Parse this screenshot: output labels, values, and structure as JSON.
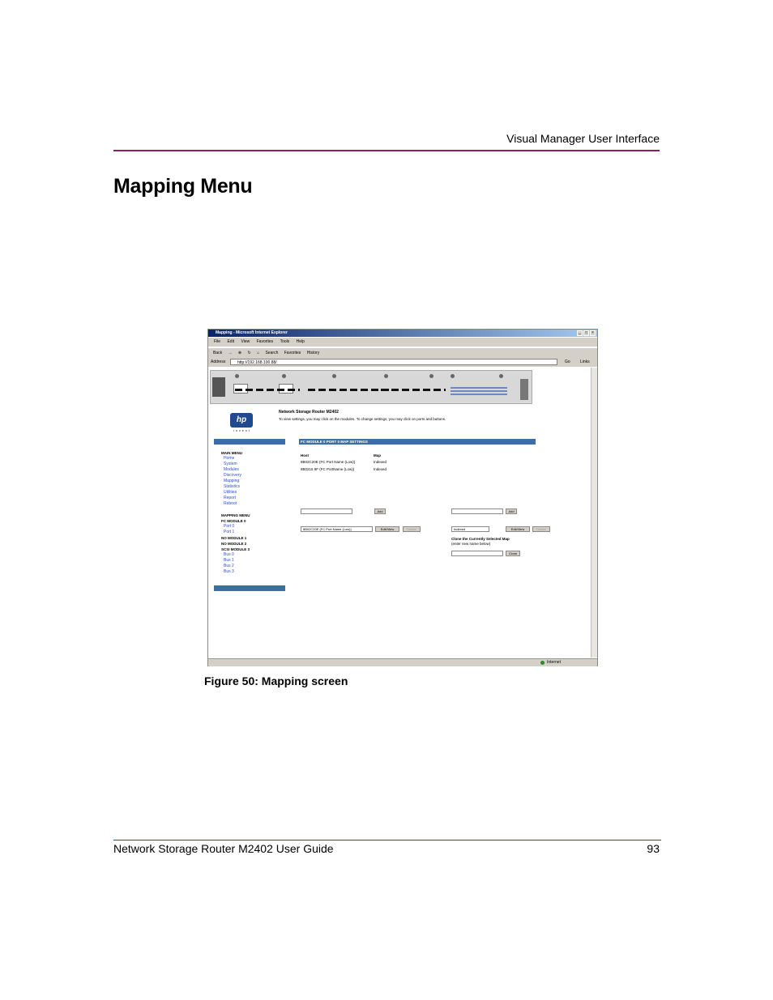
{
  "page": {
    "running_header": "Visual Manager User Interface",
    "section_title": "Mapping Menu",
    "caption": "Figure 50:  Mapping screen",
    "footer_left": "Network Storage Router M2402 User Guide",
    "footer_right": "93",
    "rule_color": "#8a1e6c"
  },
  "screenshot": {
    "window_title": "Mapping - Microsoft Internet Explorer",
    "menu": [
      "File",
      "Edit",
      "View",
      "Favorites",
      "Tools",
      "Help"
    ],
    "toolbar": [
      "Back",
      "Search",
      "Favorites",
      "History"
    ],
    "address_label": "Address",
    "address_value": "http://192.168.100.88/",
    "go_label": "Go",
    "links_label": "Links",
    "status_zone": "Internet",
    "logo_text": "hp",
    "logo_tagline": "invent",
    "router_title": "Network Storage Router M2402",
    "router_instructions": "To view settings, you may click on the modules. To change settings, you may click on ports and buttons.",
    "settings_header": "FC MODULE 0 PORT 0 MAP SETTINGS",
    "host_header": "Host",
    "map_header": "Map",
    "hosts": [
      {
        "host": "8B02C20E (FC Port Name (Low))",
        "map": "Indexed"
      },
      {
        "host": "8B0215 9F (FC PortName (Low))",
        "map": "Indexed"
      }
    ],
    "nav_main_header": "MAIN MENU",
    "nav_main_items": [
      "Home",
      "System",
      "Modules",
      "Discovery",
      "Mapping",
      "Statistics",
      "Utilities",
      "Report",
      "Reboot"
    ],
    "nav_mapping_header": "MAPPING MENU",
    "nav_fc_module": "FC MODULE 0",
    "nav_ports": [
      "Port 0",
      "Port 1"
    ],
    "nav_no_module_1": "NO MODULE 1",
    "nav_no_module_2": "NO MODULE 2",
    "nav_scsi_module": "SCSI MODULE 3",
    "nav_buses": [
      "Bus 0",
      "Bus 1",
      "Bus 2",
      "Bus 3"
    ],
    "add_label": "Add",
    "host_select_value": "8B02C20E (FC Port Name (Low))",
    "map_select_value": "Indexed",
    "edit_view_label": "Edit/View",
    "delete_label": "Delete",
    "clone_header": "Clone the Currently Selected Map",
    "clone_hint": "(enter new name below)",
    "clone_label": "Clone"
  }
}
